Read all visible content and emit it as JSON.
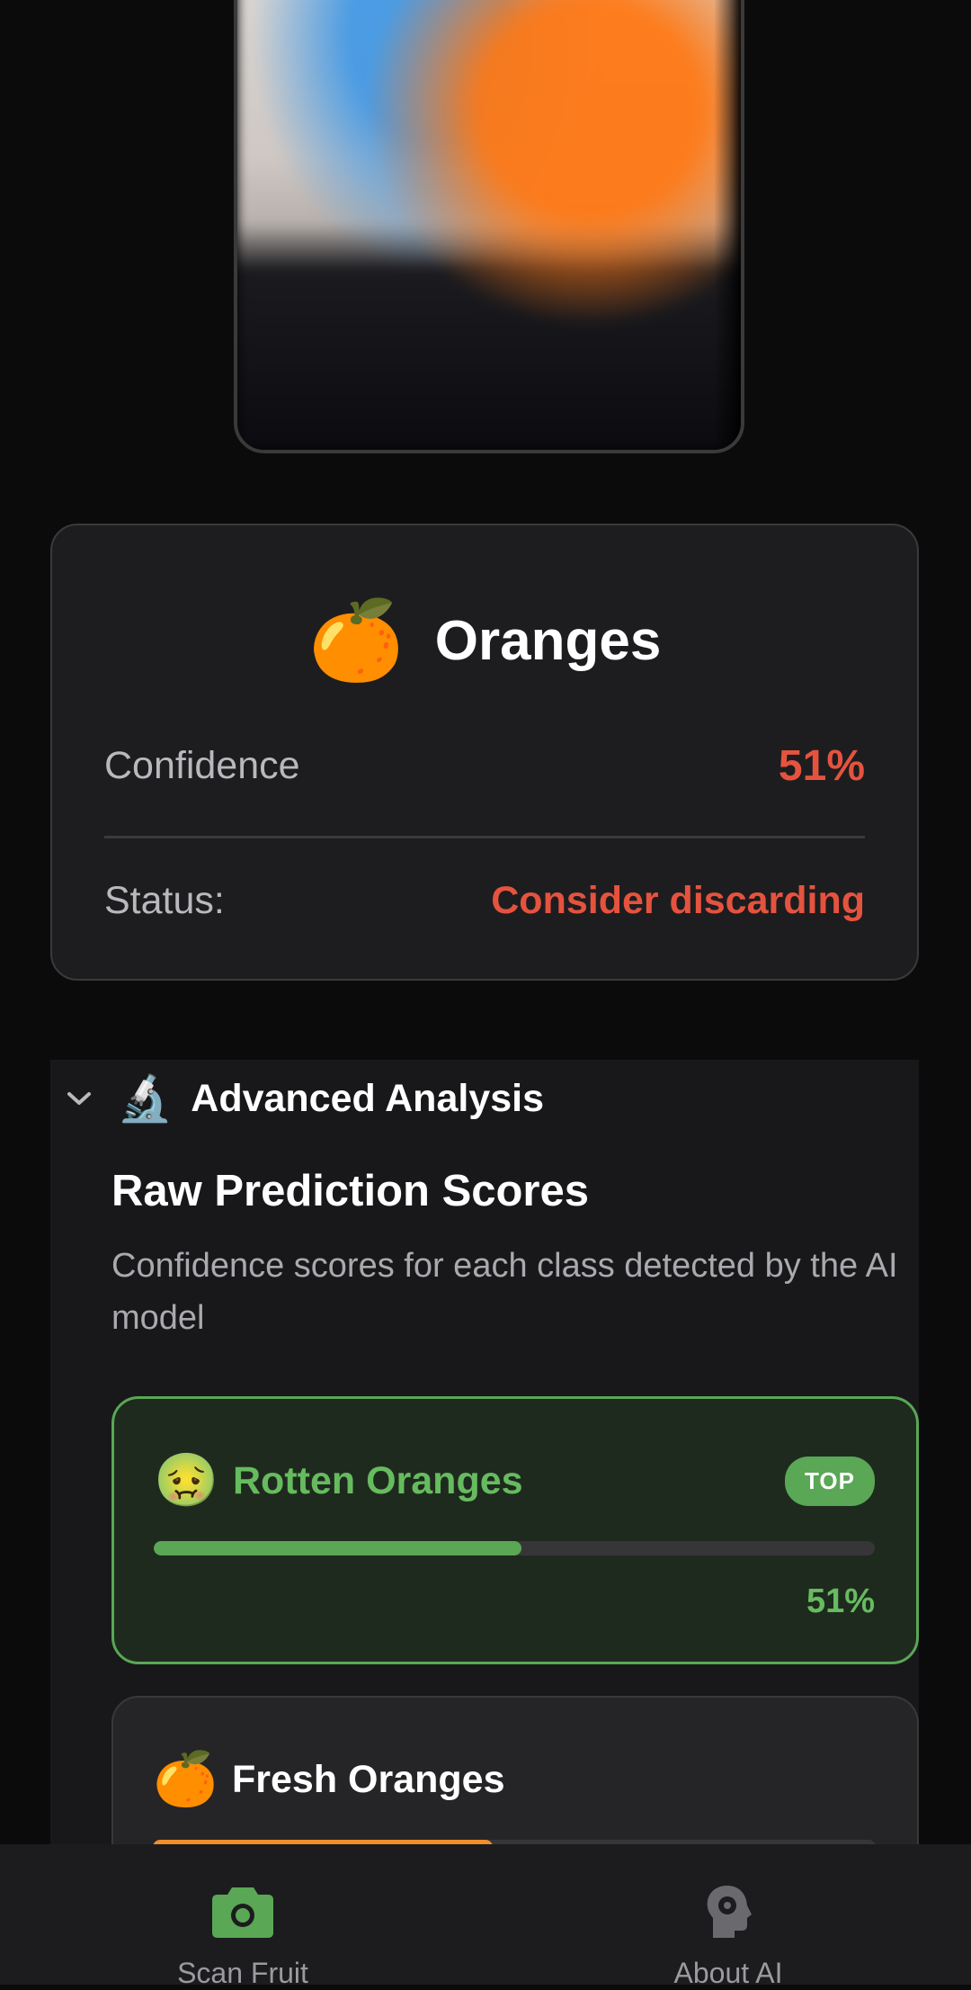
{
  "result": {
    "fruit_emoji": "🍊",
    "name": "Oranges",
    "confidence_label": "Confidence",
    "confidence_value": "51%",
    "status_label": "Status:",
    "status_value": "Consider discarding",
    "alert_color": "#e5533f"
  },
  "advanced": {
    "icon": "🔬",
    "title": "Advanced Analysis",
    "section_title": "Raw Prediction Scores",
    "section_desc": "Confidence scores for each class detected by the AI model",
    "scores": [
      {
        "emoji": "🤢",
        "name": "Rotten Oranges",
        "badge": "TOP",
        "percent_label": "51%",
        "fraction": 0.51,
        "color": "#5aa755"
      },
      {
        "emoji": "🍊",
        "name": "Fresh Oranges",
        "fraction": 0.47,
        "color": "#f08f2b"
      }
    ]
  },
  "nav": {
    "scan_label": "Scan Fruit",
    "about_label": "About AI",
    "active_color": "#5aa755",
    "icons": [
      "camera-icon",
      "ai-head-gear-icon"
    ]
  }
}
